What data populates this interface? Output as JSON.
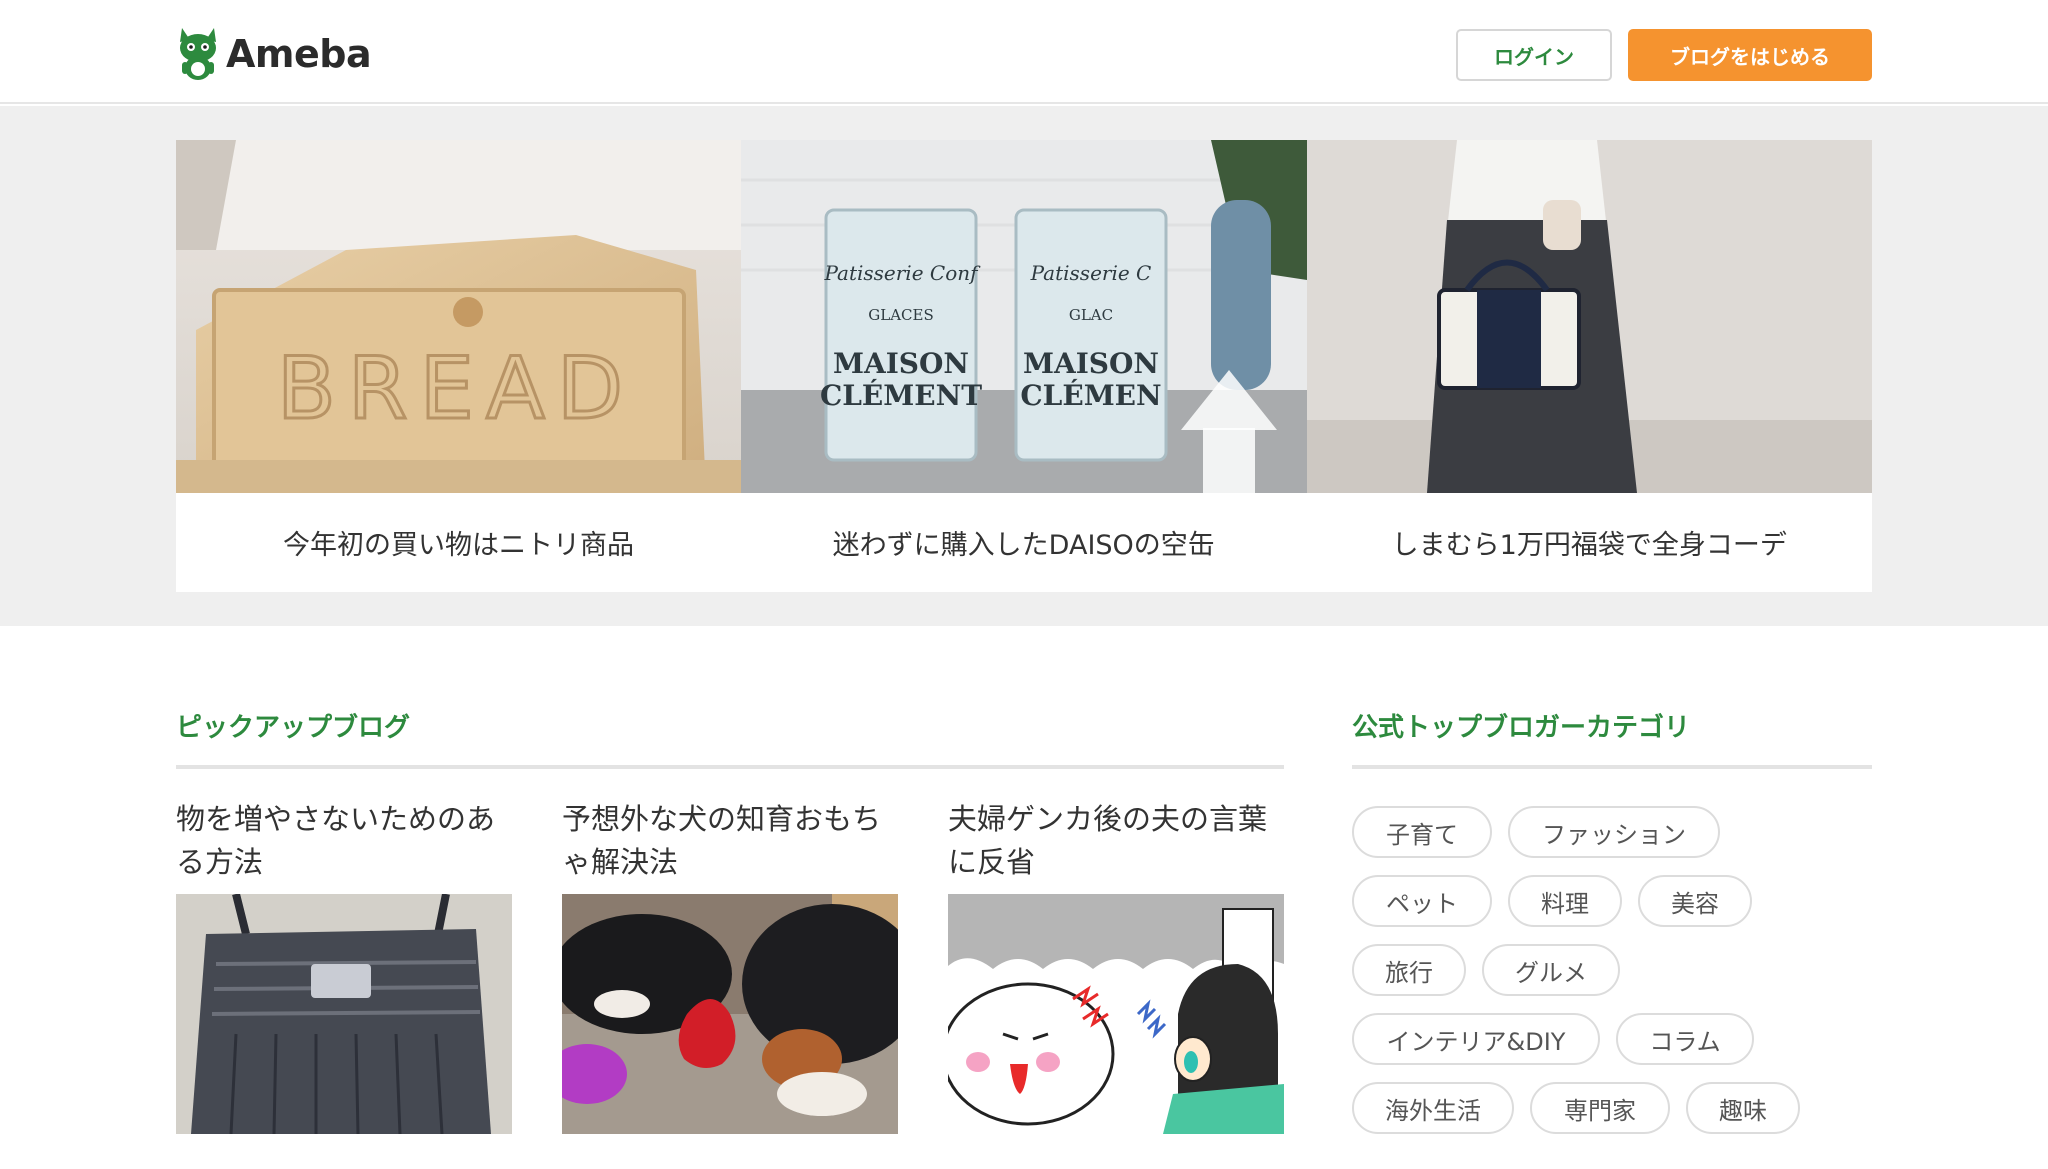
{
  "header": {
    "logo_text": "Ameba",
    "login_label": "ログイン",
    "start_label": "ブログをはじめる"
  },
  "colors": {
    "brand_green": "#2d8a3e",
    "accent_orange": "#f5932f"
  },
  "hero": {
    "cards": [
      {
        "caption": "今年初の買い物はニトリ商品",
        "image": "bread-box-photo"
      },
      {
        "caption": "迷わずに購入したDAISOの空缶",
        "image": "tin-cans-photo"
      },
      {
        "caption": "しまむら1万円福袋で全身コーデ",
        "image": "outfit-photo"
      }
    ]
  },
  "pickup": {
    "title": "ピックアップブログ",
    "items": [
      {
        "title": "物を増やさないためのある方法",
        "image": "bag-photo"
      },
      {
        "title": "予想外な犬の知育おもちゃ解決法",
        "image": "dogs-photo"
      },
      {
        "title": "夫婦ゲンカ後の夫の言葉に反省",
        "image": "comic-illustration"
      }
    ]
  },
  "categories": {
    "title": "公式トップブロガーカテゴリ",
    "tags": [
      "子育て",
      "ファッション",
      "ペット",
      "料理",
      "美容",
      "旅行",
      "グルメ",
      "インテリア&DIY",
      "コラム",
      "海外生活",
      "専門家",
      "趣味"
    ]
  }
}
